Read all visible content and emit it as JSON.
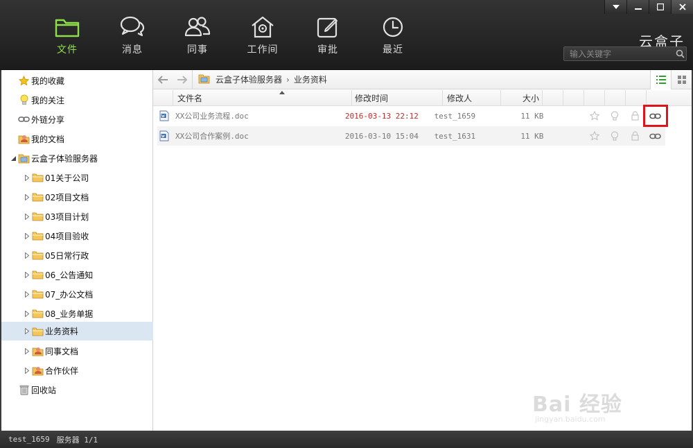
{
  "nav": [
    {
      "label": "文件",
      "icon": "folder-icon",
      "active": true
    },
    {
      "label": "消息",
      "icon": "chat-icon"
    },
    {
      "label": "同事",
      "icon": "colleagues-icon"
    },
    {
      "label": "工作间",
      "icon": "workspace-icon"
    },
    {
      "label": "审批",
      "icon": "approval-icon"
    },
    {
      "label": "最近",
      "icon": "clock-icon"
    }
  ],
  "brand": "云盒子",
  "search": {
    "placeholder": "输入关键字"
  },
  "sidebar": {
    "items": [
      {
        "label": "我的收藏",
        "icon": "star-icon"
      },
      {
        "label": "我的关注",
        "icon": "lightbulb-icon"
      },
      {
        "label": "外链分享",
        "icon": "link-icon"
      },
      {
        "label": "我的文档",
        "icon": "user-folder-icon"
      },
      {
        "label": "云盒子体验服务器",
        "icon": "server-icon"
      },
      {
        "label": "01关于公司",
        "icon": "folder-icon"
      },
      {
        "label": "02项目文档",
        "icon": "folder-icon"
      },
      {
        "label": "03项目计划",
        "icon": "folder-icon"
      },
      {
        "label": "04项目验收",
        "icon": "folder-icon"
      },
      {
        "label": "05日常行政",
        "icon": "folder-icon"
      },
      {
        "label": "06_公告通知",
        "icon": "folder-icon"
      },
      {
        "label": "07_办公文档",
        "icon": "folder-icon"
      },
      {
        "label": "08_业务单据",
        "icon": "folder-icon"
      },
      {
        "label": "业务资料",
        "icon": "folder-icon",
        "selected": true
      },
      {
        "label": "同事文档",
        "icon": "shared-folder-icon"
      },
      {
        "label": "合作伙伴",
        "icon": "shared-folder-icon"
      },
      {
        "label": "回收站",
        "icon": "trash-icon"
      }
    ]
  },
  "breadcrumb": [
    "云盒子体验服务器",
    "业务资料"
  ],
  "columns": {
    "name": "文件名",
    "modified": "修改时间",
    "modifier": "修改人",
    "size": "大小"
  },
  "files": [
    {
      "name": "XX公司业务流程.doc",
      "modified": "2016-03-13 22:12",
      "modifier": "test_1659",
      "size": "11 KB"
    },
    {
      "name": "XX公司合作案例.doc",
      "modified": "2016-03-10 15:04",
      "modifier": "test_1631",
      "size": "11 KB"
    }
  ],
  "status": {
    "user": "test_1659",
    "server": "服务器 1/1"
  },
  "watermark": {
    "text": "Bai 经验",
    "sub": "jingyan.baidu.com"
  },
  "colors": {
    "active_nav": "#8ee04a",
    "highlight": "#e0141b",
    "recent_time": "#c12a2a",
    "selected_row": "#dbe6f3"
  }
}
